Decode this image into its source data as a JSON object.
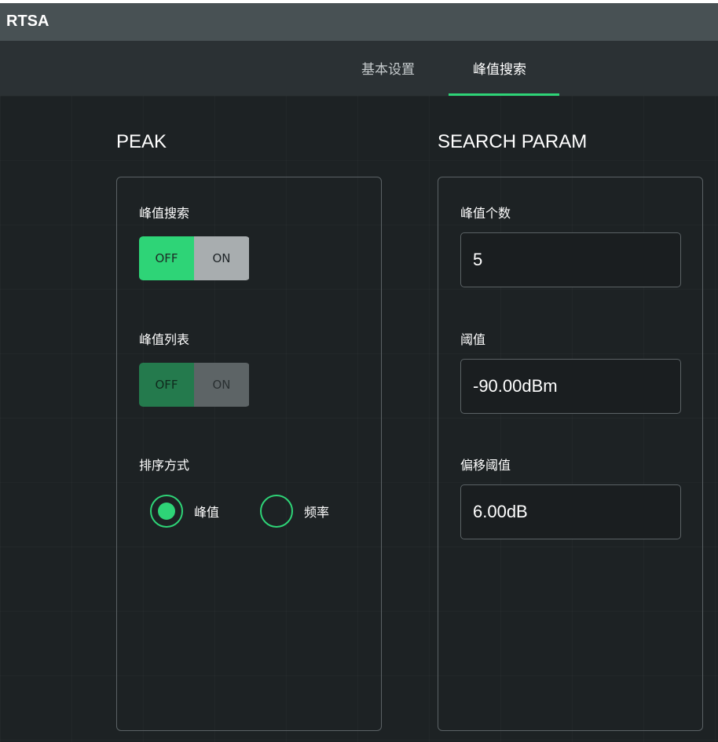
{
  "window": {
    "title": "RTSA"
  },
  "tabs": [
    {
      "label": "基本设置",
      "active": false
    },
    {
      "label": "峰值搜索",
      "active": true
    }
  ],
  "peak": {
    "section_title": "PEAK",
    "peak_search": {
      "label": "峰值搜索",
      "off_label": "OFF",
      "on_label": "ON",
      "selected": "OFF",
      "enabled": true
    },
    "peak_list": {
      "label": "峰值列表",
      "off_label": "OFF",
      "on_label": "ON",
      "selected": "OFF",
      "enabled": false
    },
    "sort_mode": {
      "label": "排序方式",
      "options": [
        {
          "label": "峰值",
          "selected": true
        },
        {
          "label": "频率",
          "selected": false
        }
      ]
    }
  },
  "search_param": {
    "section_title": "SEARCH PARAM",
    "peak_count": {
      "label": "峰值个数",
      "value": "5"
    },
    "threshold": {
      "label": "阈值",
      "value": "-90.00dBm"
    },
    "offset_threshold": {
      "label": "偏移阈值",
      "value": "6.00dB"
    }
  },
  "colors": {
    "accent": "#2ed477",
    "titlebar": "#485154",
    "tabbar": "#2b3134",
    "background": "#1e2325"
  }
}
